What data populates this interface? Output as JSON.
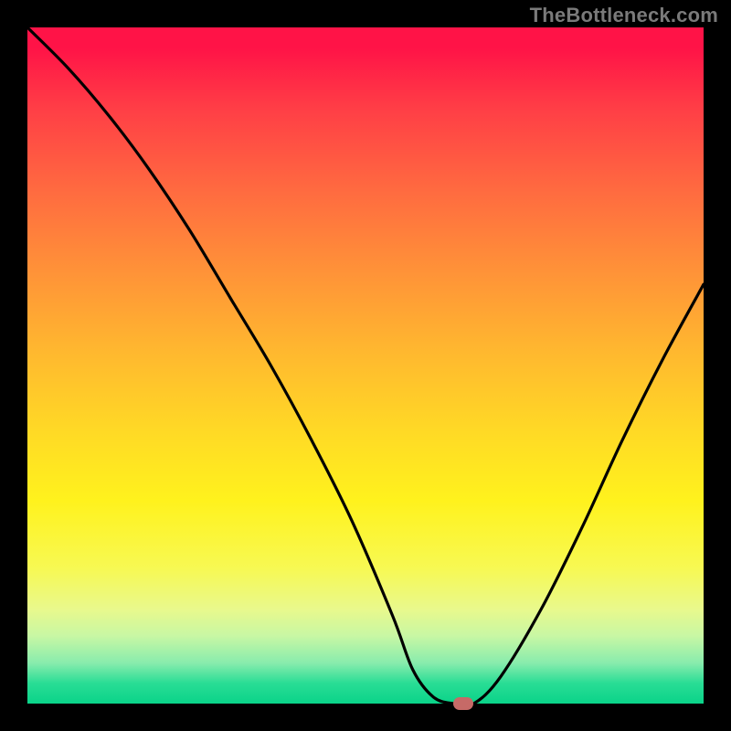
{
  "watermark": "TheBottleneck.com",
  "colors": {
    "frame": "#000000",
    "curve": "#000000",
    "marker": "#c66a67",
    "gradient_top": "#ff1347",
    "gradient_bottom": "#0ad389"
  },
  "chart_data": {
    "type": "line",
    "title": "",
    "xlabel": "",
    "ylabel": "",
    "xlim": [
      0,
      100
    ],
    "ylim": [
      0,
      100
    ],
    "grid": false,
    "legend_position": "none",
    "annotations": [
      "TheBottleneck.com"
    ],
    "series": [
      {
        "name": "bottleneck-curve",
        "x": [
          0,
          6,
          12,
          18,
          24,
          30,
          36,
          42,
          48,
          54,
          57,
          60,
          63,
          66,
          70,
          76,
          82,
          88,
          94,
          100
        ],
        "values": [
          100,
          94,
          87,
          79,
          70,
          60,
          50,
          39,
          27,
          13,
          5,
          1,
          0,
          0,
          4,
          14,
          26,
          39,
          51,
          62
        ]
      }
    ],
    "marker": {
      "x": 64.5,
      "y": 0
    }
  }
}
